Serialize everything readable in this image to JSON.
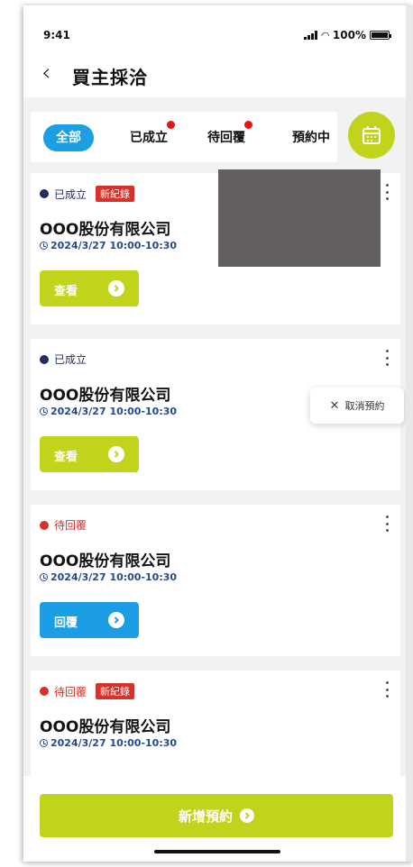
{
  "status_bar": {
    "time": "9:41",
    "battery": "100%"
  },
  "nav": {
    "title": "買主採洽"
  },
  "tabs": [
    {
      "label": "全部"
    },
    {
      "label": "已成立"
    },
    {
      "label": "待回覆"
    },
    {
      "label": "預約中"
    }
  ],
  "cards": [
    {
      "status": "已成立",
      "badge": "新紀錄",
      "company": "OOO股份有限公司",
      "datetime": "2024/3/27 10:00-10:30",
      "button_label": "查看"
    },
    {
      "status": "已成立",
      "company": "OOO股份有限公司",
      "datetime": "2024/3/27 10:00-10:30",
      "button_label": "查看"
    },
    {
      "status": "待回覆",
      "company": "OOO股份有限公司",
      "datetime": "2024/3/27 10:00-10:30",
      "button_label": "回覆"
    },
    {
      "status": "待回覆",
      "badge": "新紀錄",
      "company": "OOO股份有限公司",
      "datetime": "2024/3/27 10:00-10:30"
    }
  ],
  "popup": {
    "cancel_label": "取消預約"
  },
  "bottom": {
    "add_label": "新增預約"
  },
  "colors": {
    "accent_green": "#c2d31c",
    "accent_blue": "#1b9ee3",
    "established_dot": "#1f2d5c",
    "pending_dot": "#d6312b",
    "pending_text": "#d6312b",
    "badge_red": "#d6312b"
  }
}
